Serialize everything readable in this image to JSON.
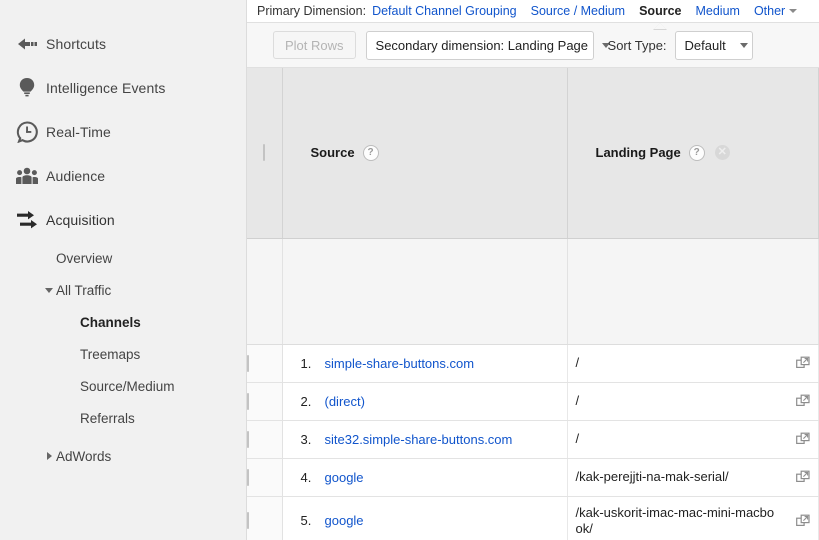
{
  "sidebar": {
    "top_items": [
      {
        "label": "Shortcuts",
        "icon": "shortcuts-arrow-icon",
        "active": false
      },
      {
        "label": "Intelligence Events",
        "icon": "lightbulb-icon",
        "active": false
      },
      {
        "label": "Real-Time",
        "icon": "clock-icon",
        "active": false
      },
      {
        "label": "Audience",
        "icon": "people-icon",
        "active": false
      },
      {
        "label": "Acquisition",
        "icon": "arrows-icon",
        "active": true
      }
    ],
    "sub_items": [
      {
        "label": "Overview",
        "level": 1,
        "selected": false,
        "toggle": "none"
      },
      {
        "label": "All Traffic",
        "level": 2,
        "selected": false,
        "toggle": "down"
      },
      {
        "label": "Channels",
        "level": 3,
        "selected": true,
        "toggle": "none"
      },
      {
        "label": "Treemaps",
        "level": 3,
        "selected": false,
        "toggle": "none"
      },
      {
        "label": "Source/Medium",
        "level": 3,
        "selected": false,
        "toggle": "none"
      },
      {
        "label": "Referrals",
        "level": 3,
        "selected": false,
        "toggle": "none"
      },
      {
        "label": "AdWords",
        "level": 2,
        "selected": false,
        "toggle": "right"
      }
    ]
  },
  "dimension_bar": {
    "label": "Primary Dimension:",
    "tabs": [
      {
        "label": "Default Channel Grouping",
        "active": false
      },
      {
        "label": "Source / Medium",
        "active": false
      },
      {
        "label": "Source",
        "active": true
      },
      {
        "label": "Medium",
        "active": false
      }
    ],
    "other_label": "Other"
  },
  "toolbar": {
    "plot_rows_label": "Plot Rows",
    "plot_rows_disabled": true,
    "secondary_dimension_label": "Secondary dimension: Landing Page",
    "sort_type_label": "Sort Type:",
    "sort_type_value": "Default"
  },
  "table": {
    "columns": [
      {
        "label": "Source",
        "has_help": true,
        "has_remove": false
      },
      {
        "label": "Landing Page",
        "has_help": true,
        "has_remove": true
      }
    ],
    "rows": [
      {
        "rank": "1.",
        "source": "simple-share-buttons.com",
        "landing_page": "/"
      },
      {
        "rank": "2.",
        "source": "(direct)",
        "landing_page": "/"
      },
      {
        "rank": "3.",
        "source": "site32.simple-share-buttons.com",
        "landing_page": "/"
      },
      {
        "rank": "4.",
        "source": "google",
        "landing_page": "/kak-perejjti-na-mak-serial/"
      },
      {
        "rank": "5.",
        "source": "google",
        "landing_page": "/kak-uskorit-imac-mac-mini-macbook/"
      }
    ]
  },
  "colors": {
    "link": "#1155cc",
    "sidebar_bg": "#f1f1f1",
    "header_bg": "#e7e7e7",
    "toolbar_bg": "#f7f7f7"
  }
}
